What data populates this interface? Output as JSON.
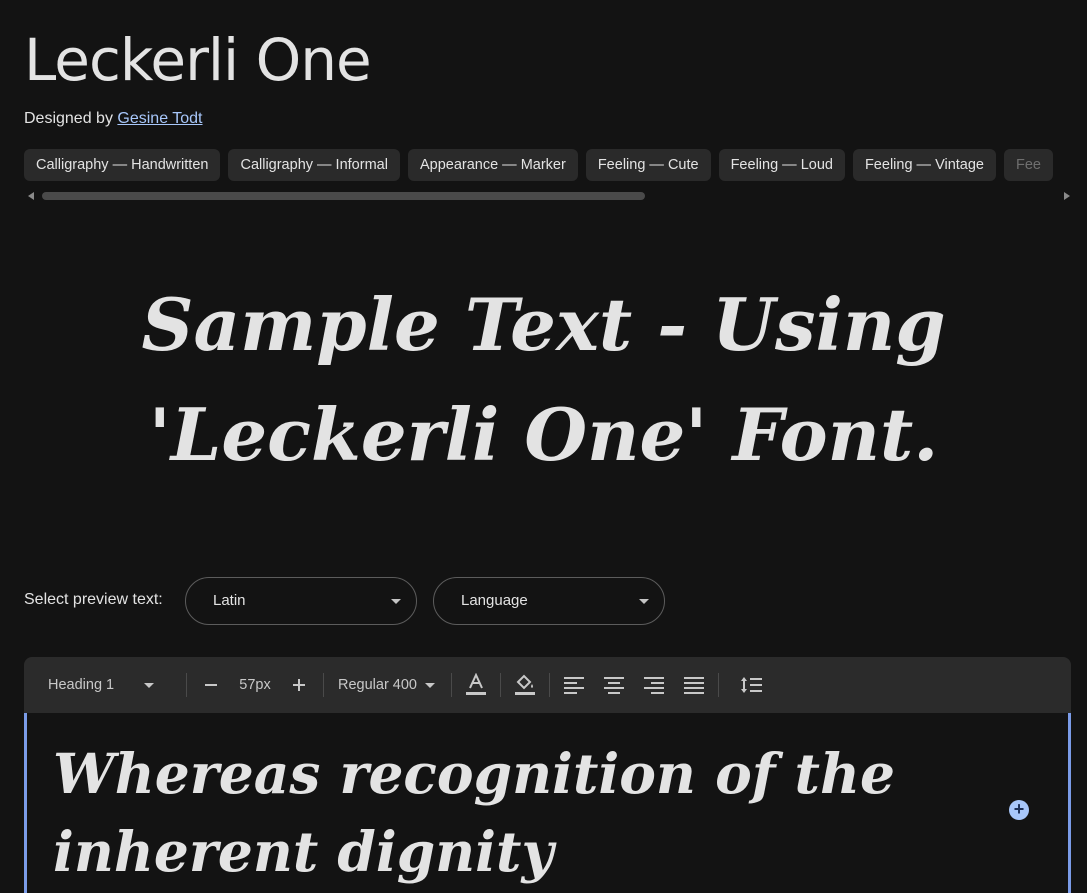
{
  "header": {
    "title": "Leckerli One",
    "designed_by_label": "Designed by",
    "designer_name": "Gesine Todt"
  },
  "tags": [
    "Calligraphy — Handwritten",
    "Calligraphy — Informal",
    "Appearance — Marker",
    "Feeling — Cute",
    "Feeling — Loud",
    "Feeling — Vintage",
    "Fee"
  ],
  "sample": {
    "line1": "Sample Text - Using",
    "line2": "'Leckerli One' Font."
  },
  "preview": {
    "label": "Select preview text:",
    "script_value": "Latin",
    "language_value": "Language"
  },
  "toolbar": {
    "style_value": "Heading 1",
    "size_value": "57px",
    "weight_value": "Regular 400",
    "icons": [
      "minus-icon",
      "plus-icon",
      "text-color-icon",
      "highlight-icon",
      "align-left-icon",
      "align-center-icon",
      "align-right-icon",
      "align-justify-icon",
      "line-height-icon"
    ]
  },
  "editor": {
    "text": "Whereas recognition of the inherent dignity"
  },
  "colors": {
    "background": "#131313",
    "chip": "#2a2a2a",
    "toolbar": "#2b2b2b",
    "link": "#a8c7fa",
    "editor_border": "#7b9ce8"
  }
}
